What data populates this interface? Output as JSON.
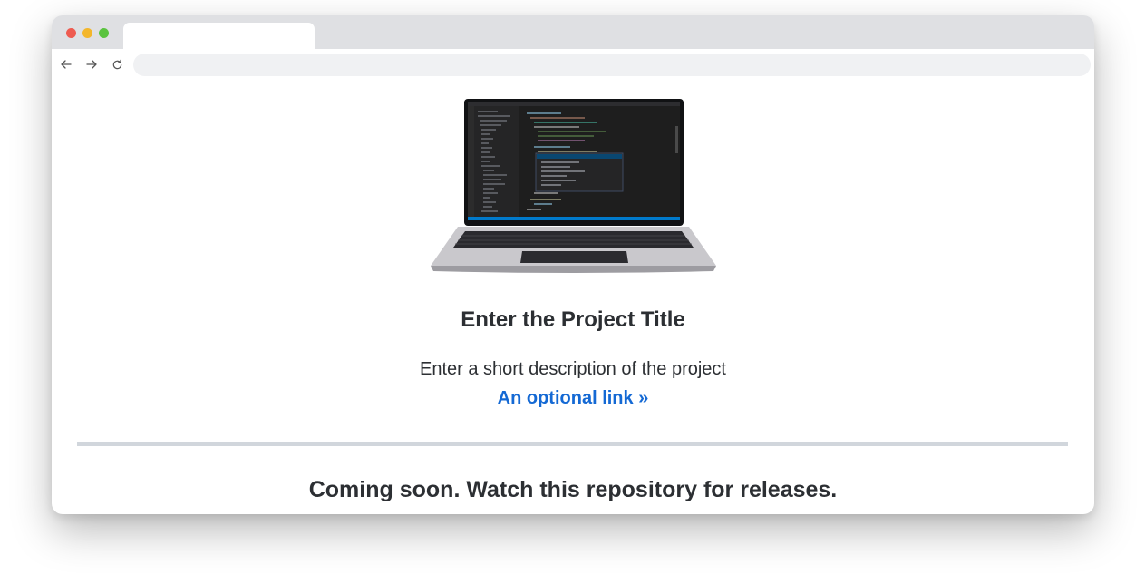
{
  "browser": {
    "tab_title": "",
    "url": "",
    "controls": {
      "close_color": "#ee5b50",
      "minimize_color": "#f3b62b",
      "maximize_color": "#5ac33f"
    }
  },
  "page": {
    "hero_image_icon": "laptop-with-code-editor",
    "title": "Enter the Project Title",
    "description": "Enter a short description of the project",
    "link_label": "An optional link »",
    "coming_soon": "Coming soon. Watch this repository for releases."
  },
  "colors": {
    "text": "#2c2f33",
    "link": "#1469d4",
    "divider": "#d1d6dc"
  }
}
